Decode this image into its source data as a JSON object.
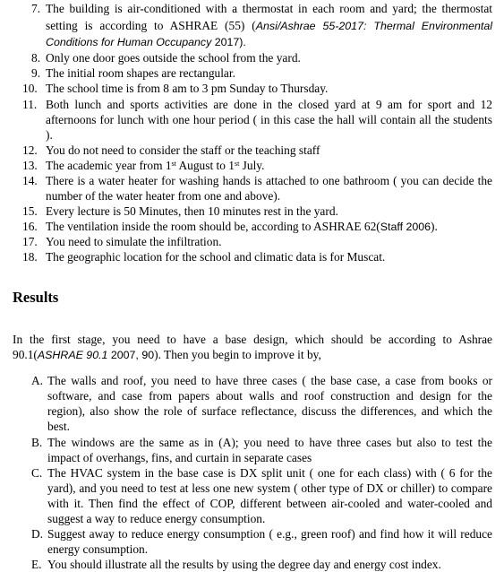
{
  "list": [
    {
      "n": "7.",
      "lines": [
        "The building is air-conditioned with a thermostat in each room and yard; the thermostat",
        "setting is according to ASHRAE (55) (",
        "Ansi/Ashrae 55-2017: Thermal Environmental",
        "Conditions for Human Occupancy",
        " 2017)."
      ]
    },
    {
      "n": "8.",
      "text": "Only one door goes outside the school from the yard."
    },
    {
      "n": "9.",
      "text": " The initial room shapes are rectangular."
    },
    {
      "n": "10.",
      "text": "The school time is from 8  am to 3 pm Sunday to Thursday."
    },
    {
      "n": "11.",
      "lines": [
        "Both lunch and sports activities are done in the closed yard at 9 am for sport and 12",
        "afternoons for lunch with one hour period ( in this case the hall will contain all the students",
        ")."
      ]
    },
    {
      "n": "12.",
      "text": "You do not need to consider the staff or the teaching staff"
    },
    {
      "n": "13.",
      "parts": [
        "The academic year from 1",
        "st",
        " August to 1",
        "st",
        " July."
      ]
    },
    {
      "n": "14.",
      "lines": [
        "There is a water heater for washing hands is attached to one bathroom ( you can decide the",
        "number of the water heater from one and above)."
      ]
    },
    {
      "n": "15.",
      "text": "Every lecture is 50 Minutes, then 10 minutes rest in the yard."
    },
    {
      "n": "16.",
      "parts": [
        "The ventilation inside the room should be, according to ASHRAE 62(",
        "Staff 2006",
        ")."
      ]
    },
    {
      "n": "17.",
      "text": "You need to simulate the infiltration."
    },
    {
      "n": "18.",
      "text": "The geographic location for the school and climatic data is for Muscat."
    }
  ],
  "results": {
    "heading": "Results",
    "intro": [
      "In the first stage, you need to have a base design, which should be according to Ashrae",
      "90.1(",
      "ASHRAE 90.1",
      " 2007, 90",
      "). Then you begin to improve it by,"
    ],
    "items": [
      {
        "n": "A.",
        "lines": [
          "The walls and roof, you need to have three cases ( the base case, a case from books or",
          "software, and case from papers about walls and roof construction and design for the",
          "region), also show the role of surface reflectance, discuss the differences, and which the",
          "best."
        ]
      },
      {
        "n": "B.",
        "lines": [
          "The windows are the same as in (A); you need to have three cases but also to test the",
          "impact of overhangs, fins, and curtain in separate cases"
        ]
      },
      {
        "n": "C.",
        "lines": [
          " The HVAC system in the base case is DX split unit ( one for each class) with ( 6 for the",
          "yard), and you need to test at less one new system ( other type of DX or chiller) to compare",
          "with it.  Then find the effect of COP, different between air-cooled and water-cooled and",
          "suggest a way to reduce energy consumption."
        ]
      },
      {
        "n": "D.",
        "lines": [
          "Suggest away to reduce energy consumption ( e.g., green roof) and find how it will reduce",
          "energy consumption."
        ]
      },
      {
        "n": "E.",
        "text": "You should illustrate all the results by using the degree day and energy cost index."
      }
    ]
  }
}
